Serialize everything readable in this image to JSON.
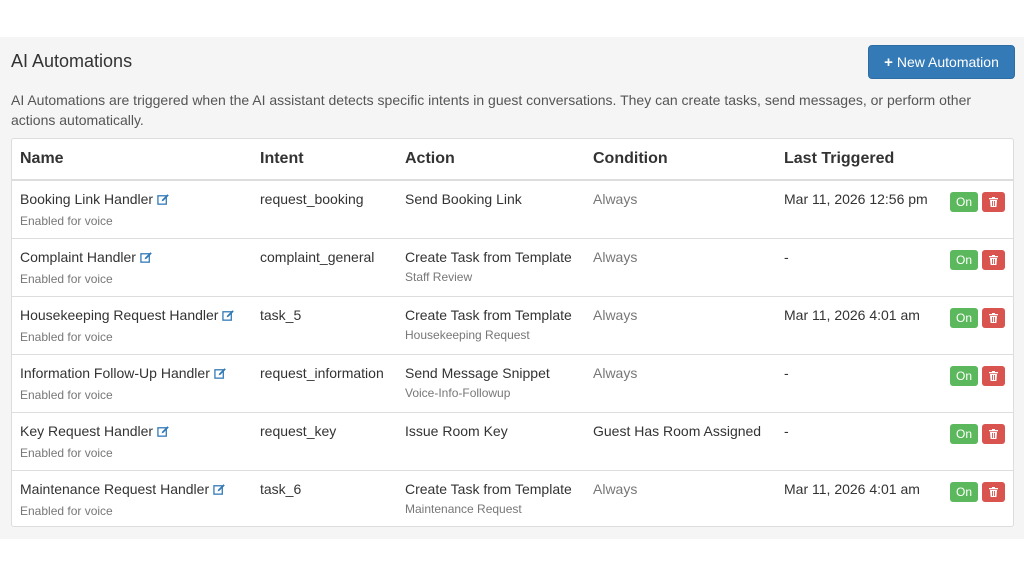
{
  "header": {
    "title": "AI Automations",
    "new_button_label": "New Automation",
    "description": "AI Automations are triggered when the AI assistant detects specific intents in guest conversations. They can create tasks, send messages, or perform other actions automatically."
  },
  "table": {
    "columns": [
      "Name",
      "Intent",
      "Action",
      "Condition",
      "Last Triggered"
    ],
    "rows": [
      {
        "name": "Booking Link Handler",
        "name_sub": "Enabled for voice",
        "intent": "request_booking",
        "action": "Send Booking Link",
        "action_sub": "",
        "condition": "Always",
        "last_triggered": "Mar 11, 2026 12:56 pm",
        "toggle": "On"
      },
      {
        "name": "Complaint Handler",
        "name_sub": "Enabled for voice",
        "intent": "complaint_general",
        "action": "Create Task from Template",
        "action_sub": "Staff Review",
        "condition": "Always",
        "last_triggered": "-",
        "toggle": "On"
      },
      {
        "name": "Housekeeping Request Handler",
        "name_sub": "Enabled for voice",
        "intent": "task_5",
        "action": "Create Task from Template",
        "action_sub": "Housekeeping Request",
        "condition": "Always",
        "last_triggered": "Mar 11, 2026 4:01 am",
        "toggle": "On"
      },
      {
        "name": "Information Follow-Up Handler",
        "name_sub": "Enabled for voice",
        "intent": "request_information",
        "action": "Send Message Snippet",
        "action_sub": "Voice-Info-Followup",
        "condition": "Always",
        "last_triggered": "-",
        "toggle": "On"
      },
      {
        "name": "Key Request Handler",
        "name_sub": "Enabled for voice",
        "intent": "request_key",
        "action": "Issue Room Key",
        "action_sub": "",
        "condition": "Guest Has Room Assigned",
        "last_triggered": "-",
        "toggle": "On"
      },
      {
        "name": "Maintenance Request Handler",
        "name_sub": "Enabled for voice",
        "intent": "task_6",
        "action": "Create Task from Template",
        "action_sub": "Maintenance Request",
        "condition": "Always",
        "last_triggered": "Mar 11, 2026 4:01 am",
        "toggle": "On"
      }
    ]
  },
  "icons": {
    "edit": "edit-icon",
    "delete": "trash-icon",
    "add": "plus-icon"
  },
  "colors": {
    "primary": "#337ab7",
    "success": "#5cb85c",
    "danger": "#d9534f",
    "link": "#337ab7"
  }
}
